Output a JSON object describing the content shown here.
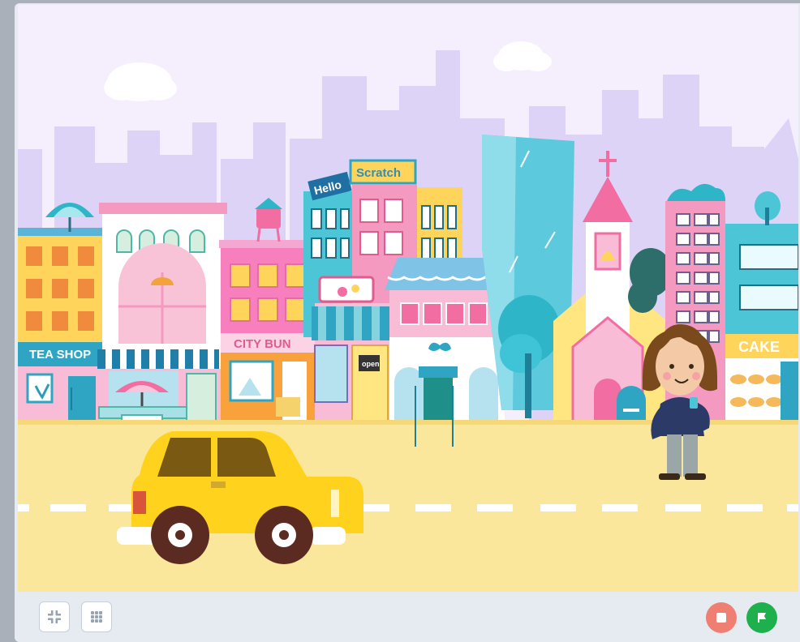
{
  "stage": {
    "signs": {
      "hello": "Hello",
      "scratch": "Scratch",
      "tea_shop": "TEA SHOP",
      "city_bun": "CITY BUN",
      "cake": "CAKE",
      "open": "open"
    }
  },
  "controls": {
    "left_buttons": [
      "exit-fullscreen-icon",
      "small-stage-grid-icon"
    ],
    "stop_button_color": "#ef7f72",
    "green_flag_button_color": "#1db04d"
  },
  "colors": {
    "sky": "#f5eefc",
    "skyline": "#dcd3f6",
    "street": "#fbe79c",
    "road_dash": "#ffffff",
    "taxi": "#ffd21e",
    "panel": "#e6ebf1"
  }
}
